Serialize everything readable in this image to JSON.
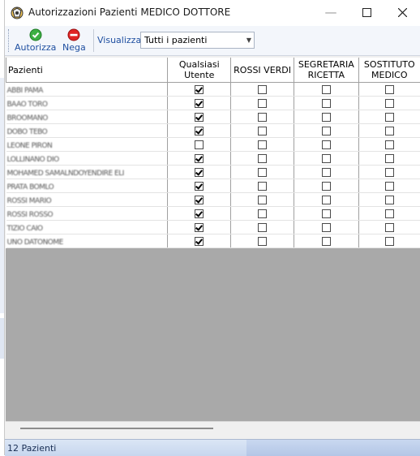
{
  "window": {
    "title": "Autorizzazioni Pazienti MEDICO DOTTORE"
  },
  "toolbar": {
    "authorize_label": "Autorizza",
    "deny_label": "Nega",
    "view_label": "Visualizza",
    "view_value": "Tutti i pazienti"
  },
  "grid": {
    "columns": [
      "Pazienti",
      "Qualsiasi Utente",
      "ROSSI VERDI",
      "SEGRETARIA RICETTA",
      "SOSTITUTO MEDICO"
    ],
    "rows": [
      {
        "name": "ABBI PAMA",
        "checks": [
          true,
          false,
          false,
          false
        ]
      },
      {
        "name": "BAAO TORO",
        "checks": [
          true,
          false,
          false,
          false
        ]
      },
      {
        "name": "BROOMANO",
        "checks": [
          true,
          false,
          false,
          false
        ]
      },
      {
        "name": "DOBO TEBO",
        "checks": [
          true,
          false,
          false,
          false
        ]
      },
      {
        "name": "LEONE PIRON",
        "checks": [
          false,
          false,
          false,
          false
        ]
      },
      {
        "name": "LOLLINANO DIO",
        "checks": [
          true,
          false,
          false,
          false
        ]
      },
      {
        "name": "MOHAMED SAMALNDOYENDIRE ELI",
        "checks": [
          true,
          false,
          false,
          false
        ]
      },
      {
        "name": "PRATA BOMLO",
        "checks": [
          true,
          false,
          false,
          false
        ]
      },
      {
        "name": "ROSSI MARIO",
        "checks": [
          true,
          false,
          false,
          false
        ]
      },
      {
        "name": "ROSSI ROSSO",
        "checks": [
          true,
          false,
          false,
          false
        ]
      },
      {
        "name": "TIZIO CAIO",
        "checks": [
          true,
          false,
          false,
          false
        ]
      },
      {
        "name": "UNO DATONOME",
        "checks": [
          true,
          false,
          false,
          false
        ]
      }
    ]
  },
  "status": {
    "count_text": "12 Pazienti"
  },
  "colors": {
    "statusbar": "#c7d6ee",
    "grid_background": "#a9a9a9",
    "toolbar_text": "#1f4fa0"
  },
  "icons": {
    "authorize": "green-check-icon",
    "deny": "red-minus-icon"
  }
}
